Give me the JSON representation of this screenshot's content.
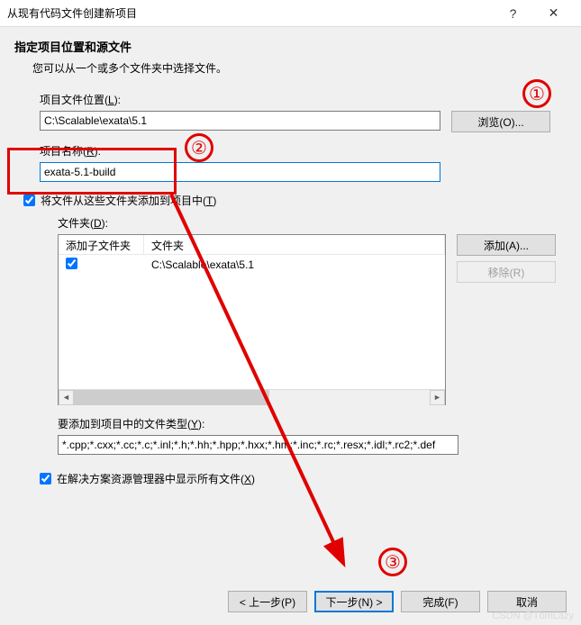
{
  "titlebar": {
    "title": "从现有代码文件创建新项目",
    "help": "?",
    "close": "✕"
  },
  "header": {
    "heading": "指定项目位置和源文件",
    "subheading": "您可以从一个或多个文件夹中选择文件。"
  },
  "fields": {
    "location_label_pre": "项目文件位置(",
    "location_label_key": "L",
    "location_label_post": "):",
    "location_value": "C:\\Scalable\\exata\\5.1",
    "browse_label": "浏览(O)...",
    "name_label_pre": "项目名称(",
    "name_label_key": "R",
    "name_label_post": "):",
    "name_value": "exata-5.1-build"
  },
  "add_folders": {
    "checkbox_label_pre": "将文件从这些文件夹添加到项目中(",
    "checkbox_label_key": "T",
    "checkbox_label_post": ")",
    "folder_label_pre": "文件夹(",
    "folder_label_key": "D",
    "folder_label_post": "):",
    "col_sub": "添加子文件夹",
    "col_folder": "文件夹",
    "rows": [
      {
        "subfolder_checked": true,
        "folder": "C:\\Scalable\\exata\\5.1"
      }
    ],
    "add_btn": "添加(A)...",
    "remove_btn": "移除(R)"
  },
  "file_types": {
    "label_pre": "要添加到项目中的文件类型(",
    "label_key": "Y",
    "label_post": "):",
    "value": "*.cpp;*.cxx;*.cc;*.c;*.inl;*.h;*.hh;*.hpp;*.hxx;*.hm;*.inc;*.rc;*.resx;*.idl;*.rc2;*.def"
  },
  "show_all": {
    "label_pre": "在解决方案资源管理器中显示所有文件(",
    "label_key": "X",
    "label_post": ")"
  },
  "buttons": {
    "prev": "< 上一步(P)",
    "next": "下一步(N) >",
    "finish": "完成(F)",
    "cancel": "取消"
  },
  "annotations": {
    "one": "①",
    "two": "②",
    "three": "③"
  },
  "watermark": "CSDN @TbmLazy"
}
